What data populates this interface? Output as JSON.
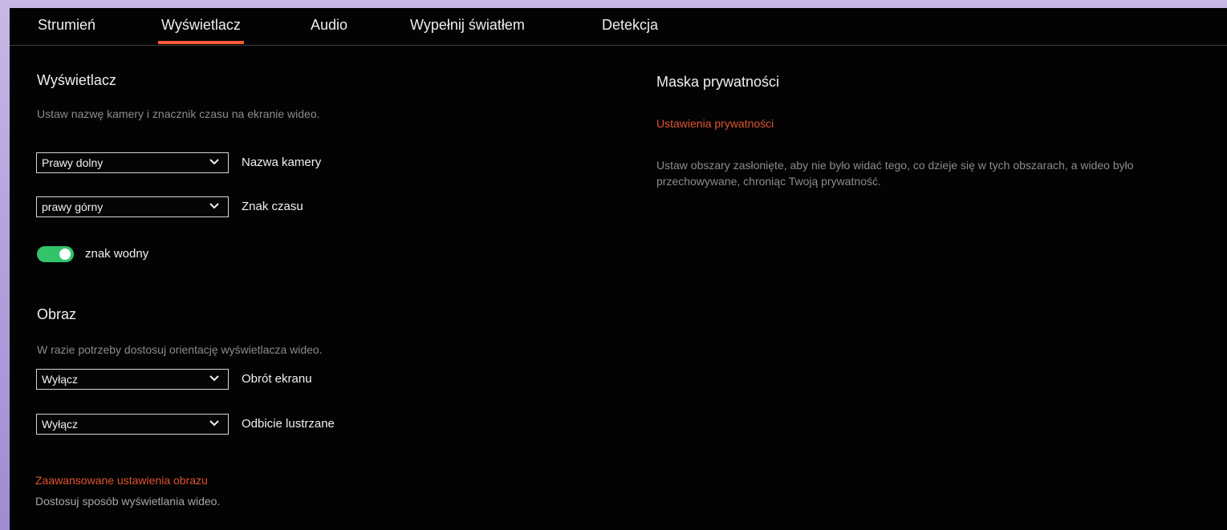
{
  "tabs": [
    {
      "label": "Strumień"
    },
    {
      "label": "Wyświetlacz"
    },
    {
      "label": "Audio"
    },
    {
      "label": "Wypełnij światłem"
    },
    {
      "label": "Detekcja"
    }
  ],
  "active_tab": "Wyświetlacz",
  "display": {
    "title": "Wyświetlacz",
    "description": "Ustaw nazwę kamery i znacznik czasu na ekranie wideo.",
    "camera_name": {
      "value": "Prawy dolny",
      "label": "Nazwa kamery"
    },
    "timestamp": {
      "value": "prawy górny",
      "label": "Znak czasu"
    },
    "watermark": {
      "label": "znak wodny",
      "enabled": true
    }
  },
  "image": {
    "title": "Obraz",
    "description": "W razie potrzeby dostosuj orientację wyświetlacza wideo.",
    "rotation": {
      "value": "Wyłącz",
      "label": "Obrót ekranu"
    },
    "mirror": {
      "value": "Wyłącz",
      "label": "Odbicie lustrzane"
    },
    "advanced_link": "Zaawansowane ustawienia obrazu",
    "advanced_desc": "Dostosuj sposób wyświetlania wideo."
  },
  "privacy": {
    "title": "Maska prywatności",
    "settings_link": "Ustawienia prywatności",
    "description": "Ustaw obszary zasłonięte, aby nie było widać tego, co dzieje się w tych obszarach, a wideo było przechowywane, chroniąc Twoją prywatność."
  },
  "colors": {
    "background": "#030303",
    "accent": "#ff5a36",
    "link": "#e0542f",
    "toggle_on": "#31c46b",
    "muted_text": "#8b8b8b"
  }
}
